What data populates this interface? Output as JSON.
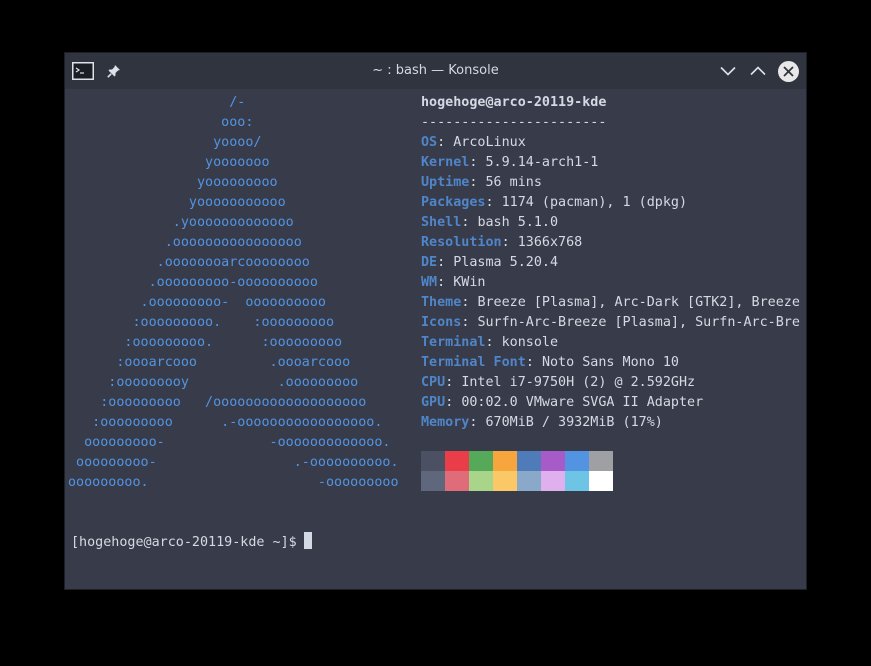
{
  "window": {
    "title": "~ : bash — Konsole"
  },
  "icons": {
    "terminal": "terminal-icon",
    "pin": "pin-icon",
    "minimize": "chevron-down-icon",
    "maximize": "chevron-up-icon",
    "close": "close-icon"
  },
  "logo_lines": [
    "                    /-",
    "                   ooo:",
    "                  yoooo/",
    "                 yooooooo",
    "                yooooooooo",
    "               yooooooooooo",
    "             .yooooooooooooo",
    "            .oooooooooooooooo",
    "           .oooooooarcoooooooo",
    "          .ooooooooo-oooooooooo",
    "         .ooooooooo-  oooooooooo",
    "        :ooooooooo.    :ooooooooo",
    "       :ooooooooo.      :ooooooooo",
    "      :oooarcooo         .oooarcooo",
    "     :ooooooooy           .ooooooooo",
    "    :ooooooooo   /ooooooooooooooooooo",
    "   :ooooooooo      .-ooooooooooooooooo.",
    "  ooooooooo-             -ooooooooooooo.",
    " ooooooooo-                 .-oooooooooo.",
    "ooooooooo.                     -ooooooooo"
  ],
  "info": {
    "userhost": "hogehoge@arco-20119-kde",
    "separator": "-----------------------",
    "fields": [
      {
        "key": "OS",
        "value": "ArcoLinux"
      },
      {
        "key": "Kernel",
        "value": "5.9.14-arch1-1"
      },
      {
        "key": "Uptime",
        "value": "56 mins"
      },
      {
        "key": "Packages",
        "value": "1174 (pacman), 1 (dpkg)"
      },
      {
        "key": "Shell",
        "value": "bash 5.1.0"
      },
      {
        "key": "Resolution",
        "value": "1366x768"
      },
      {
        "key": "DE",
        "value": "Plasma 5.20.4"
      },
      {
        "key": "WM",
        "value": "KWin"
      },
      {
        "key": "Theme",
        "value": "Breeze [Plasma], Arc-Dark [GTK2], Breeze"
      },
      {
        "key": "Icons",
        "value": "Surfn-Arc-Breeze [Plasma], Surfn-Arc-Bre"
      },
      {
        "key": "Terminal",
        "value": "konsole"
      },
      {
        "key": "Terminal Font",
        "value": "Noto Sans Mono 10"
      },
      {
        "key": "CPU",
        "value": "Intel i7-9750H (2) @ 2.592GHz"
      },
      {
        "key": "GPU",
        "value": "00:02.0 VMware SVGA II Adapter"
      },
      {
        "key": "Memory",
        "value": "670MiB / 3932MiB (17%)"
      }
    ]
  },
  "palette": {
    "row1": [
      "#4b5162",
      "#e93d4a",
      "#57a95a",
      "#f7a63d",
      "#4f7bb8",
      "#a75bc9",
      "#5294e2",
      "#9ea0a4"
    ],
    "row2": [
      "#5f677c",
      "#e06c7a",
      "#a8d58a",
      "#fbc867",
      "#8aa8c9",
      "#e0b0ee",
      "#6ec4e4",
      "#ffffff"
    ]
  },
  "prompt": {
    "text": "[hogehoge@arco-20119-kde ~]$"
  },
  "colors": {
    "accent": "#5294e2",
    "key": "#4f85c9",
    "background": "#383c4a",
    "titlebar": "#2f343f"
  }
}
